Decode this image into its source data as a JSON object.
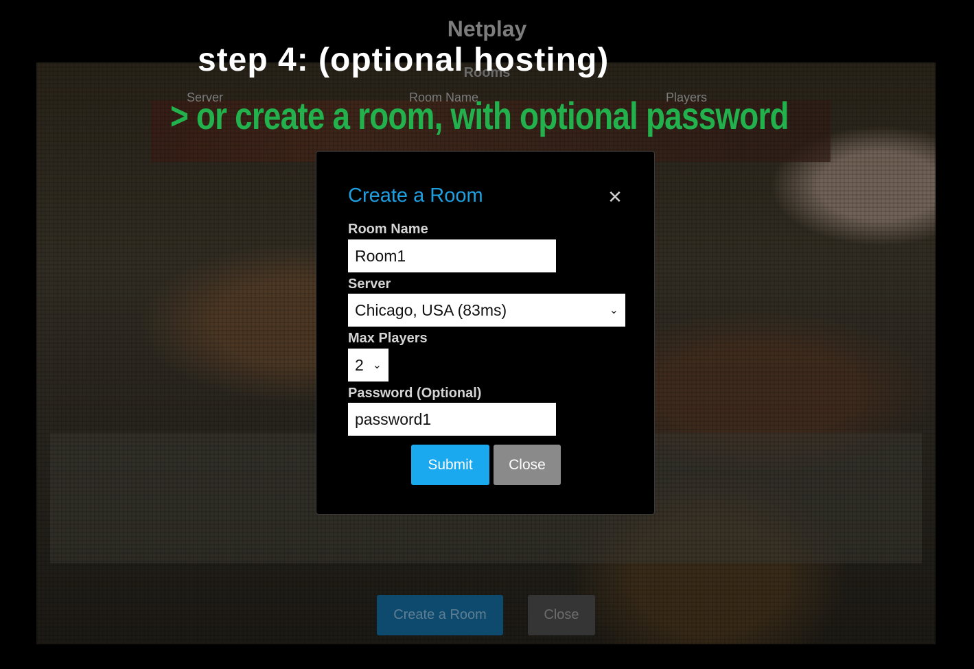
{
  "netplay": {
    "title": "Netplay",
    "rooms_heading": "Rooms",
    "columns": [
      "Server",
      "Room Name",
      "Players"
    ],
    "create_room_label": "Create a Room",
    "close_label": "Close"
  },
  "tutorial": {
    "step_title": "step 4:  (optional hosting)",
    "step_subtitle": "> or create a room, with optional password",
    "subtitle_color": "#22b14c"
  },
  "modal": {
    "title": "Create a Room",
    "close_icon": "close-icon",
    "fields": {
      "room_name_label": "Room Name",
      "room_name_value": "Room1",
      "server_label": "Server",
      "server_value": "Chicago, USA (83ms)",
      "max_players_label": "Max Players",
      "max_players_value": "2",
      "password_label": "Password (Optional)",
      "password_value": "password1"
    },
    "submit_label": "Submit",
    "close_label": "Close"
  },
  "colors": {
    "accent": "#1d9fe0",
    "submit_button": "#1aa8ee",
    "close_button": "#8a8a8a"
  }
}
